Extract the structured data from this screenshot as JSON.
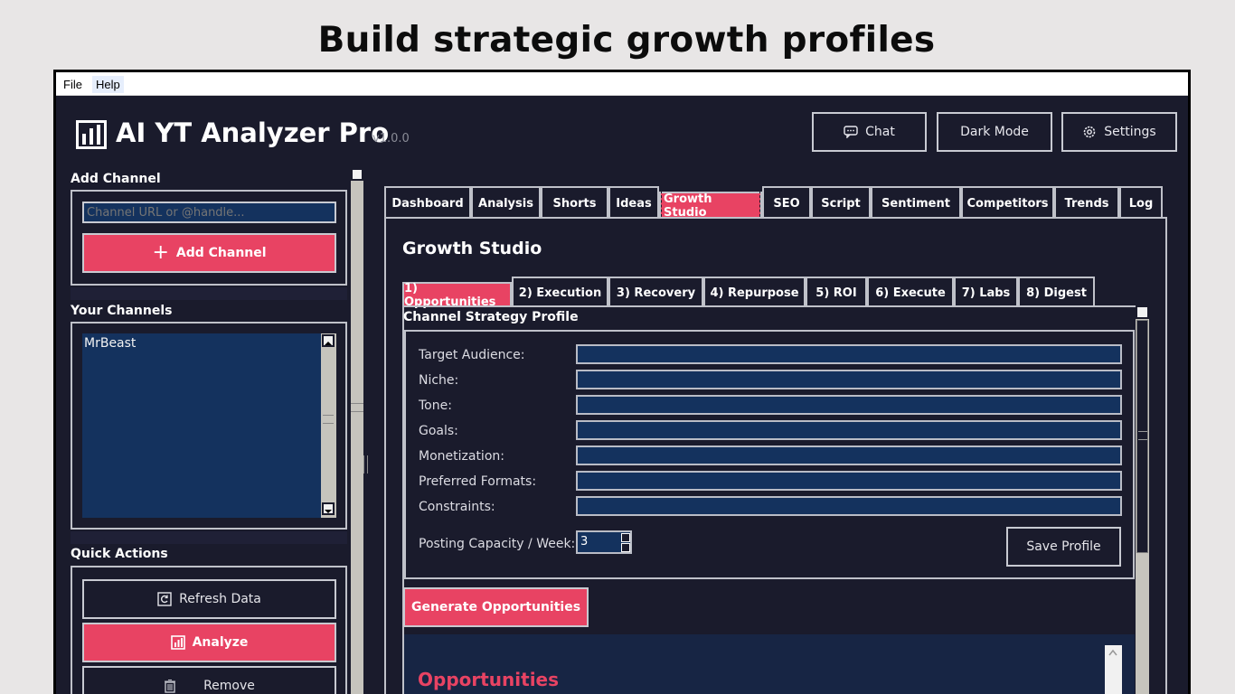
{
  "headline": "Build strategic growth profiles",
  "menu": {
    "file": "File",
    "help": "Help"
  },
  "app": {
    "title": "AI YT Analyzer Pro",
    "version": "v1.0.0"
  },
  "header_buttons": {
    "chat": "Chat",
    "dark_mode": "Dark Mode",
    "settings": "Settings"
  },
  "sidebar": {
    "add_channel_label": "Add Channel",
    "channel_input_placeholder": "Channel URL or @handle...",
    "add_channel_button": "Add Channel",
    "your_channels_label": "Your Channels",
    "channels": [
      "MrBeast"
    ],
    "quick_actions_label": "Quick Actions",
    "refresh_button": "Refresh Data",
    "analyze_button": "Analyze",
    "remove_button": "Remove"
  },
  "tabs": [
    "Dashboard",
    "Analysis",
    "Shorts",
    "Ideas",
    "Growth Studio",
    "SEO",
    "Script",
    "Sentiment",
    "Competitors",
    "Trends",
    "Log"
  ],
  "active_tab": "Growth Studio",
  "growth_studio": {
    "title": "Growth Studio",
    "subtabs": [
      "1) Opportunities",
      "2) Execution",
      "3) Recovery",
      "4) Repurpose",
      "5) ROI",
      "6) Execute",
      "7) Labs",
      "8) Digest"
    ],
    "active_subtab": "1) Opportunities",
    "profile_section_label": "Channel Strategy Profile",
    "fields": [
      {
        "label": "Target Audience:",
        "value": ""
      },
      {
        "label": "Niche:",
        "value": ""
      },
      {
        "label": "Tone:",
        "value": ""
      },
      {
        "label": "Goals:",
        "value": ""
      },
      {
        "label": "Monetization:",
        "value": ""
      },
      {
        "label": "Preferred Formats:",
        "value": ""
      },
      {
        "label": "Constraints:",
        "value": ""
      }
    ],
    "posting_capacity_label": "Posting Capacity / Week:",
    "posting_capacity_value": "3",
    "save_profile_button": "Save Profile",
    "generate_button": "Generate Opportunities",
    "opportunities_heading": "Opportunities"
  },
  "colors": {
    "accent": "#e84363",
    "background": "#1a1b2c",
    "input": "#14325e"
  }
}
